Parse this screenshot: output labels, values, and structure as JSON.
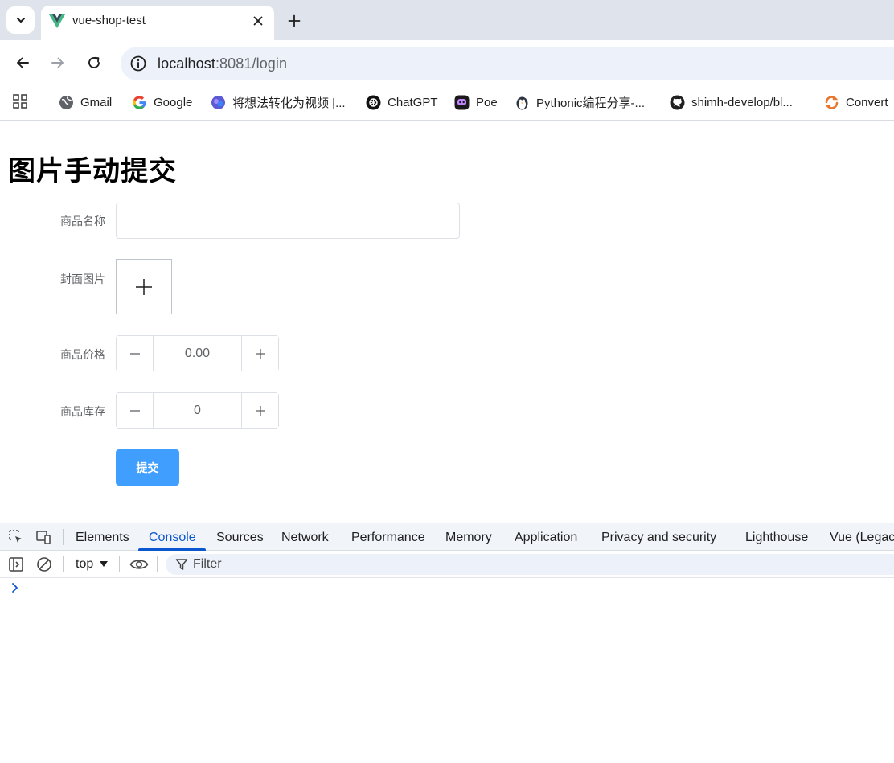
{
  "browser": {
    "tab_title": "vue-shop-test",
    "url_host": "localhost",
    "url_rest": ":8081/login",
    "bookmarks": [
      {
        "label": "Gmail",
        "icon": "globe-icon"
      },
      {
        "label": "Google",
        "icon": "google-icon"
      },
      {
        "label": "将想法转化为视频 |...",
        "icon": "video-ai-icon"
      },
      {
        "label": "ChatGPT",
        "icon": "chatgpt-icon"
      },
      {
        "label": "Poe",
        "icon": "poe-icon"
      },
      {
        "label": "Pythonic编程分享-...",
        "icon": "penguin-icon"
      },
      {
        "label": "shimh-develop/bl...",
        "icon": "github-icon"
      },
      {
        "label": "Convert",
        "icon": "convert-icon"
      }
    ]
  },
  "page": {
    "heading": "图片手动提交",
    "form": {
      "name_label": "商品名称",
      "name_value": "",
      "cover_label": "封面图片",
      "price_label": "商品价格",
      "price_value": "0.00",
      "stock_label": "商品库存",
      "stock_value": "0",
      "submit_label": "提交"
    }
  },
  "devtools": {
    "tabs": [
      "Elements",
      "Console",
      "Sources",
      "Network",
      "Performance",
      "Memory",
      "Application",
      "Privacy and security",
      "Lighthouse",
      "Vue (Legacy)"
    ],
    "active_tab": "Console",
    "context": "top",
    "filter_placeholder": "Filter"
  },
  "colors": {
    "primary_button": "#409eff",
    "active_tab": "#0b57d0"
  }
}
